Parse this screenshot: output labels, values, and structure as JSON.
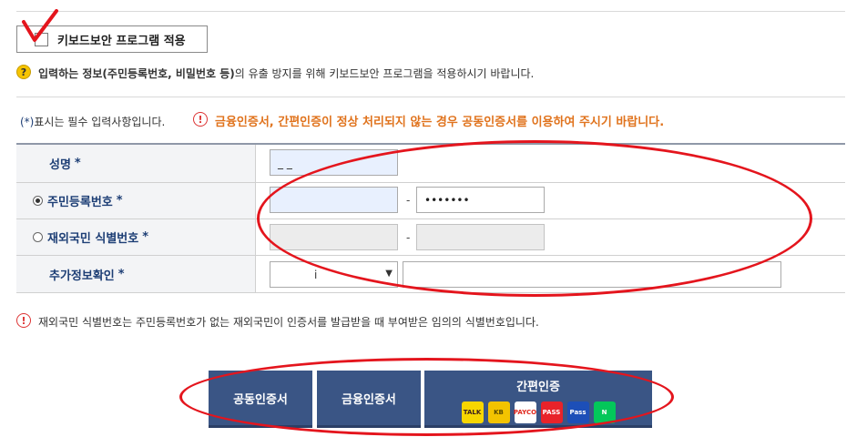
{
  "keyboard_security": {
    "label": "키보드보안 프로그램 적용",
    "checked": true
  },
  "notice": {
    "text_bold": "입력하는 정보(주민등록번호, 비밀번호 등)",
    "text_rest": "의 유출 방지를 위해 키보드보안 프로그램을 적용하시기 바랍니다."
  },
  "required": {
    "mark": "(*)",
    "text": "표시는 필수 입력사항입니다."
  },
  "warning": {
    "text": "금융인증서, 간편인증이 정상 처리되지 않는 경우 공동인증서를 이용하여 주시기 바랍니다."
  },
  "form": {
    "name": {
      "label": "성명",
      "star": "*",
      "value": "_ _"
    },
    "rrn": {
      "label": "주민등록번호",
      "star": "*",
      "selected": true,
      "front": "",
      "dash": "-",
      "back": "•••••••"
    },
    "foreign": {
      "label": "재외국민 식별번호",
      "star": "*",
      "selected": false,
      "dash": "-"
    },
    "extra": {
      "label": "추가정보확인",
      "star": "*",
      "select_value": "i",
      "arrow": "▼",
      "input_value": ""
    }
  },
  "foreign_note": "재외국민 식별번호는 주민등록번호가 없는 재외국민이 인증서를 발급받을 때 부여받은 임의의 식별번호입니다.",
  "buttons": {
    "joint_cert": "공동인증서",
    "financial_cert": "금융인증서",
    "simple_auth": "간편인증",
    "simple_logos": [
      {
        "name": "kakao",
        "label": "TALK",
        "color": "#f7d600",
        "text_color": "#3b1e1e"
      },
      {
        "name": "kb",
        "label": "KB",
        "color": "#f3c300",
        "text_color": "#5a4a00"
      },
      {
        "name": "payco",
        "label": "PAYCO",
        "color": "#ffffff",
        "text_color": "#e0261c"
      },
      {
        "name": "pass",
        "label": "PASS",
        "color": "#e8232a",
        "text_color": "#ffffff"
      },
      {
        "name": "samsung-pass",
        "label": "Pass",
        "color": "#1d4fb8",
        "text_color": "#ffffff"
      },
      {
        "name": "naver",
        "label": "N",
        "color": "#03c75a",
        "text_color": "#ffffff"
      }
    ]
  },
  "colors": {
    "accent_navy": "#3a5585",
    "label_blue": "#1d3e75",
    "warning_orange": "#e0731d",
    "annotation_red": "#e4151d"
  }
}
